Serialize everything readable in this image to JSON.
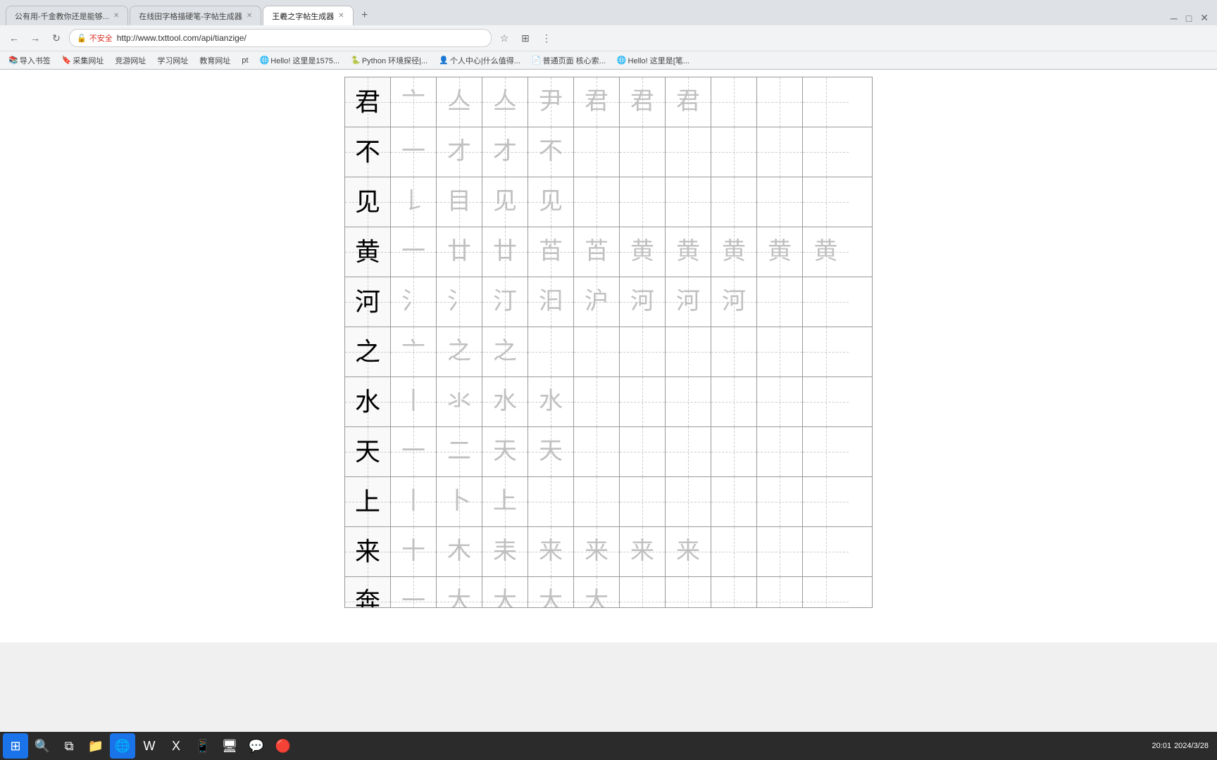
{
  "browser": {
    "tabs": [
      {
        "label": "公有用-千金教你还是能够...",
        "active": false
      },
      {
        "label": "在线田字格描硬笔-字帖生成器",
        "active": false
      },
      {
        "label": "王羲之字帖生成器",
        "active": true
      }
    ],
    "url": "http://www.txttool.com/api/tianzige/",
    "security_label": "不安全",
    "bookmarks": [
      "导入书签",
      "采集网址",
      "竞游网址",
      "学习网址",
      "教育网址",
      "pt",
      "Hello! 这里是1575...",
      "Python 环境探径|...",
      "个人中心|什么值得...",
      "普通页面 核心索...",
      "Hello! 这里是[笔..."
    ]
  },
  "characters": [
    {
      "char": "君",
      "strokes": [
        "亠",
        "亼",
        "亼",
        "亼",
        "尹",
        "君",
        "君",
        "君"
      ],
      "empty": 3
    },
    {
      "char": "不",
      "strokes": [
        "一",
        "才",
        "才",
        "不"
      ],
      "empty": 7
    },
    {
      "char": "见",
      "strokes": [
        "𠄌",
        "𠄀",
        "见",
        "见"
      ],
      "empty": 7
    },
    {
      "char": "黄",
      "strokes": [
        "一",
        "廿",
        "廿",
        "廿",
        "黃",
        "黃",
        "黃",
        "黄",
        "黄",
        "黄",
        "黄"
      ],
      "empty": 0
    },
    {
      "char": "河",
      "strokes": [
        "氵",
        "氵",
        "汀",
        "泊",
        "汪",
        "河",
        "河",
        "河"
      ],
      "empty": 3
    },
    {
      "char": "之",
      "strokes": [
        "亠",
        "之",
        "之"
      ],
      "empty": 8
    },
    {
      "char": "水",
      "strokes": [
        "丨",
        "氺",
        "水",
        "水"
      ],
      "empty": 7
    },
    {
      "char": "天",
      "strokes": [
        "一",
        "三",
        "天",
        "天"
      ],
      "empty": 7
    },
    {
      "char": "上",
      "strokes": [
        "丨",
        "卜",
        "上"
      ],
      "empty": 8
    },
    {
      "char": "来",
      "strokes": [
        "十",
        "木",
        "耒",
        "来",
        "来",
        "来",
        "来"
      ],
      "empty": 4
    },
    {
      "char": "奔",
      "strokes": [
        "一",
        "大",
        "大",
        "大",
        "大"
      ],
      "empty": 6
    }
  ],
  "taskbar": {
    "time": "20:01",
    "date": "2024/3/28"
  }
}
